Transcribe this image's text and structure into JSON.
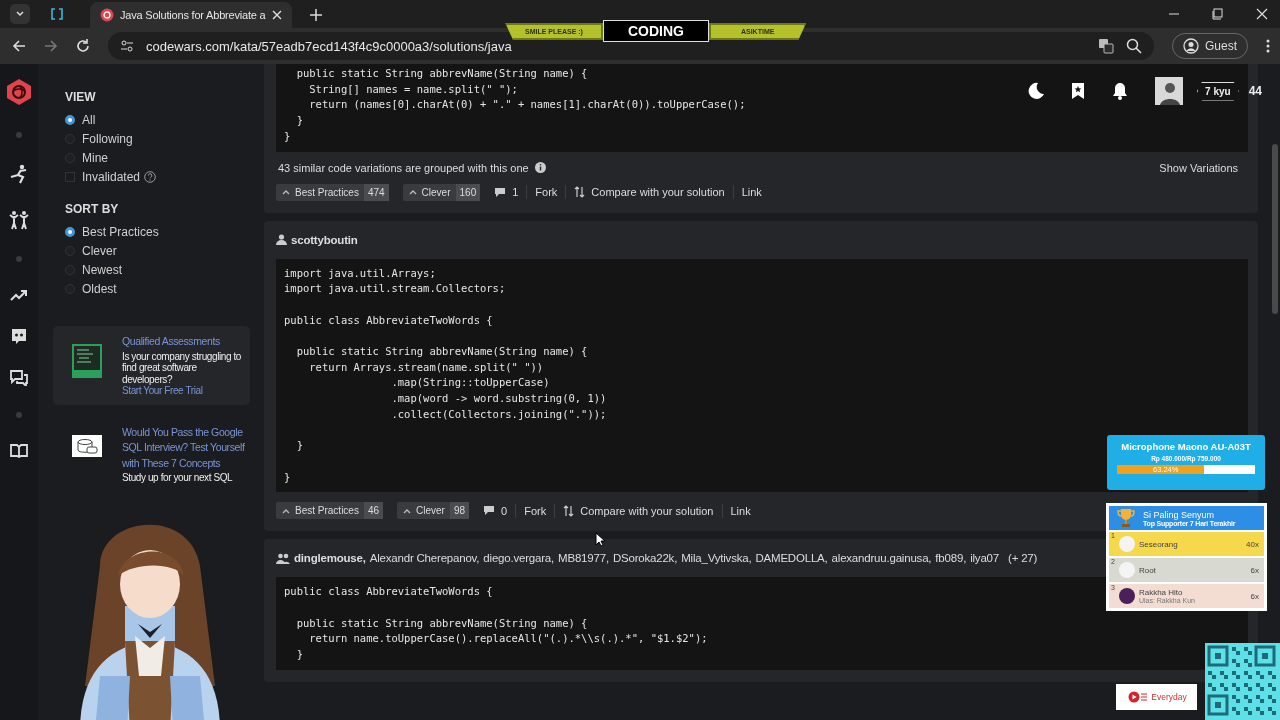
{
  "browser": {
    "tab_title": "Java Solutions for Abbreviate a",
    "url": "codewars.com/kata/57eadb7ecd143f4c9c0000a3/solutions/java",
    "profile": "Guest"
  },
  "stream_banner": {
    "left": "SMILE PLEASE :)",
    "center": "CODING",
    "right": "ASIKTIME"
  },
  "header": {
    "rank": "7 kyu",
    "honor": "44"
  },
  "rail": [
    {
      "kind": "logo"
    },
    {
      "kind": "dot"
    },
    {
      "kind": "kata"
    },
    {
      "kind": "dojo"
    },
    {
      "kind": "dot"
    },
    {
      "kind": "trend"
    },
    {
      "kind": "discord"
    },
    {
      "kind": "chat"
    },
    {
      "kind": "dot"
    },
    {
      "kind": "book"
    }
  ],
  "sidebar": {
    "view_heading": "VIEW",
    "view_options": [
      {
        "label": "All",
        "selected": true
      },
      {
        "label": "Following",
        "selected": false
      },
      {
        "label": "Mine",
        "selected": false
      }
    ],
    "invalidated": {
      "label": "Invalidated",
      "checked": false
    },
    "sort_heading": "SORT BY",
    "sort_options": [
      {
        "label": "Best Practices",
        "selected": true
      },
      {
        "label": "Clever",
        "selected": false
      },
      {
        "label": "Newest",
        "selected": false
      },
      {
        "label": "Oldest",
        "selected": false
      }
    ],
    "ads": [
      {
        "kind": "qualified",
        "title": "Qualified Assessments",
        "text": "Is your company struggling to find great software developers?",
        "link": "Start Your Free Trial"
      },
      {
        "kind": "sql",
        "title": "Would You Pass the Google SQL Interview? Test Yourself with These 7 Concepts",
        "text": "Study up for your next SQL"
      }
    ]
  },
  "solutions": [
    {
      "code": "  public static String abbrevName(String name) {\n    String[] names = name.split(\" \");\n    return (names[0].charAt(0) + \".\" + names[1].charAt(0)).toUpperCase();\n  }\n}",
      "variations": {
        "text": "43 similar code variations are grouped with this one",
        "action": "Show Variations"
      },
      "votes": [
        {
          "label": "Best Practices",
          "count": "474"
        },
        {
          "label": "Clever",
          "count": "160"
        }
      ],
      "comments": "1",
      "fork": "Fork",
      "compare": "Compare with your solution",
      "link": "Link"
    },
    {
      "authors": [
        "scottyboutin"
      ],
      "code": "import java.util.Arrays;\nimport java.util.stream.Collectors;\n\npublic class AbbreviateTwoWords {\n\n  public static String abbrevName(String name) {\n    return Arrays.stream(name.split(\" \"))\n                 .map(String::toUpperCase)\n                 .map(word -> word.substring(0, 1))\n                 .collect(Collectors.joining(\".\"));\n\n  }\n\n}",
      "votes": [
        {
          "label": "Best Practices",
          "count": "46"
        },
        {
          "label": "Clever",
          "count": "98"
        }
      ],
      "comments": "0",
      "fork": "Fork",
      "compare": "Compare with your solution",
      "link": "Link"
    },
    {
      "authors": [
        "dinglemouse,",
        "Alexandr Cherepanov,",
        "diego.vergara,",
        "MB81977,",
        "DSoroka22k,",
        "Mila_Vytivska,",
        "DAMEDOLLA,",
        "alexandruu.gainusa,",
        "fb089,",
        "ilya07"
      ],
      "more": "(+ 27)",
      "code": "public class AbbreviateTwoWords {\n\n  public static String abbrevName(String name) {\n    return name.toUpperCase().replaceAll(\"(.).*\\\\s(.).*\", \"$1.$2\");\n  }"
    }
  ],
  "overlays": {
    "goal": {
      "title": "Microphone Maono AU-A03T",
      "amount": "Rp 480.000/Rp 759.000",
      "level": 0.63,
      "percent": "63.24%"
    },
    "leaderboard": {
      "title": "Si Paling Senyum",
      "subtitle": "Top Supporter 7 Hari Terakhir",
      "rows": [
        {
          "rank": "1",
          "name": "Seseorang",
          "count": "40x",
          "color": "#f6d84c"
        },
        {
          "rank": "2",
          "name": "Root",
          "count": "6x",
          "color": "#d8d9d0"
        },
        {
          "rank": "3",
          "name": "Rakkha Hito",
          "sub": "Ulas: Rakkha Kun",
          "count": "6x",
          "color": "#f3ddd3"
        }
      ]
    },
    "brand": {
      "text": "Everyday"
    }
  }
}
